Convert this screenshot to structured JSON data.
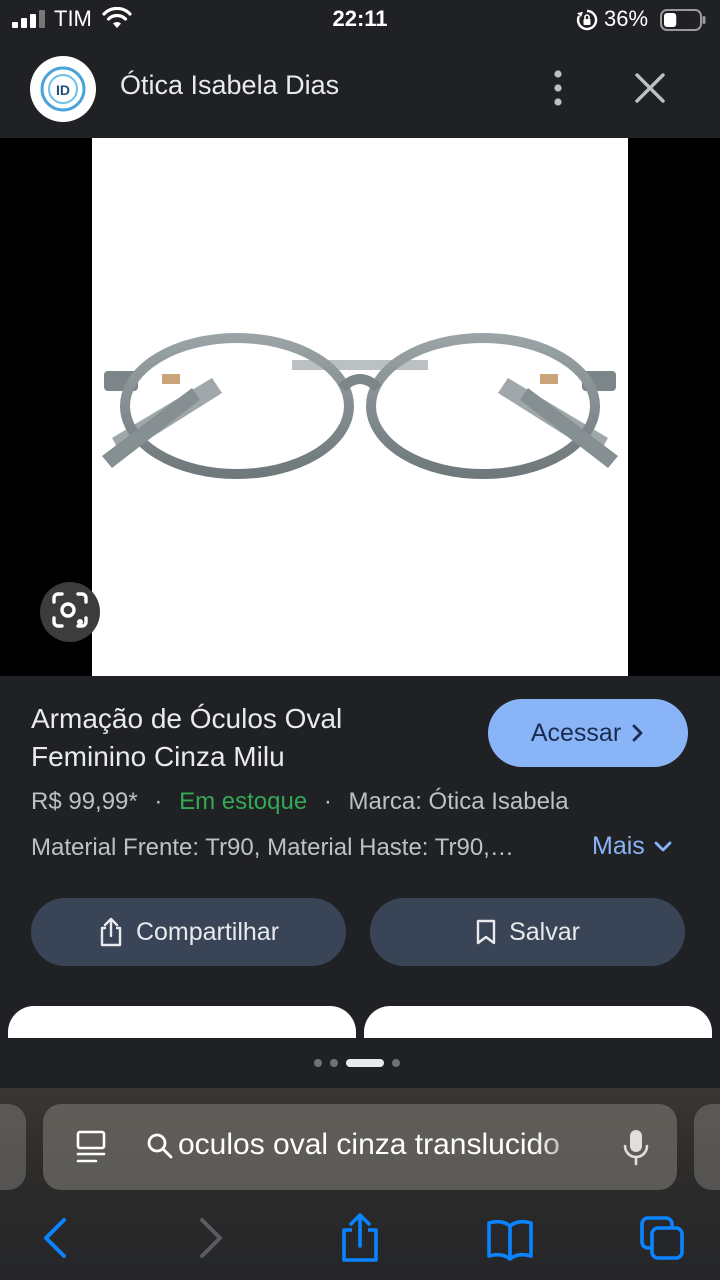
{
  "status_bar": {
    "carrier": "TIM",
    "time": "22:11",
    "battery_percent": "36%",
    "battery_level": 0.36
  },
  "header": {
    "logo_text": "ID",
    "title": "Ótica Isabela Dias"
  },
  "product": {
    "title": "Armação de Óculos Oval Feminino Cinza Milu",
    "visit_label": "Acessar",
    "price": "R$ 99,99*",
    "separator": "·",
    "stock": "Em estoque",
    "brand": "Marca: Ótica Isabela",
    "specs": "Material Frente: Tr90, Material Haste: Tr90,…",
    "more_label": "Mais"
  },
  "actions": {
    "share_label": "Compartilhar",
    "save_label": "Salvar"
  },
  "carousel": {
    "dots": 4,
    "active_index": 2
  },
  "address_bar": {
    "query": "oculos oval cinza translucido"
  },
  "colors": {
    "accent": "#8ab4f8",
    "in_stock": "#34a853",
    "background": "#202124",
    "pill": "#394457",
    "toolbar_icon": "#0a84ff"
  }
}
